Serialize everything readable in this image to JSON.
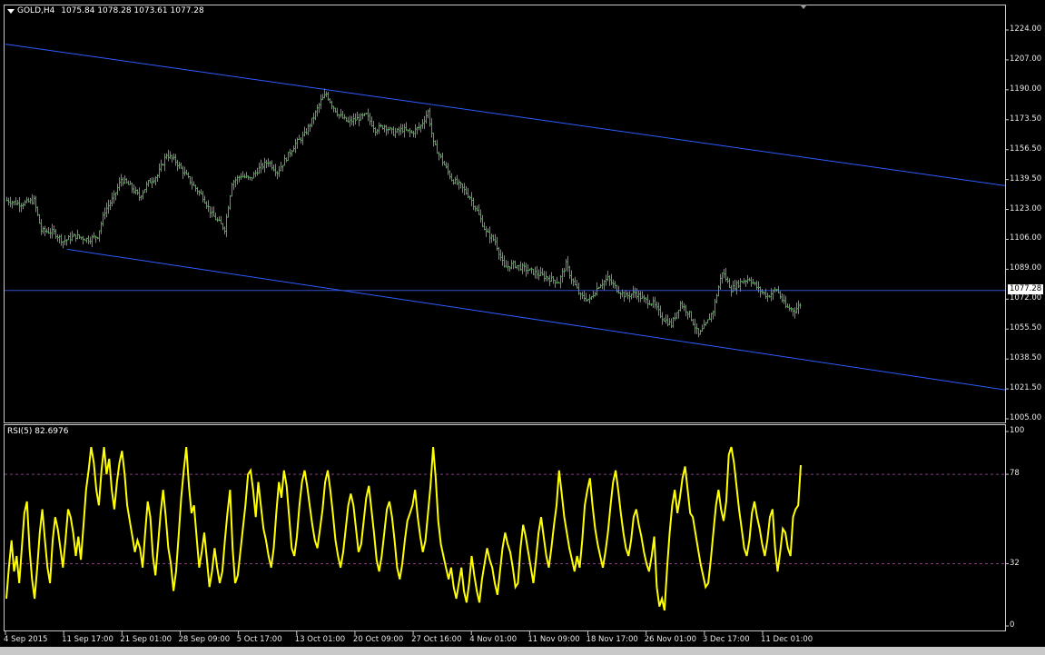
{
  "header": {
    "symbol": "GOLD,H4",
    "open": "1075.84",
    "high": "1078.28",
    "low": "1073.61",
    "close": "1077.28"
  },
  "indicator": {
    "name": "RSI(5)",
    "value": "82.6976"
  },
  "current_price_label": "1077.28",
  "chart_data": [
    {
      "type": "ohlc",
      "symbol": "GOLD",
      "timeframe": "H4",
      "y_ticks": [
        "1224.00",
        "1207.00",
        "1190.00",
        "1173.50",
        "1156.50",
        "1139.50",
        "1123.00",
        "1106.00",
        "1089.00",
        "1072.00",
        "1055.50",
        "1038.50",
        "1021.50",
        "1005.00"
      ],
      "ylim": [
        1005,
        1224
      ],
      "x_ticks": [
        "4 Sep 2015",
        "11 Sep 17:00",
        "21 Sep 01:00",
        "28 Sep 09:00",
        "5 Oct 17:00",
        "13 Oct 01:00",
        "20 Oct 09:00",
        "27 Oct 16:00",
        "4 Nov 01:00",
        "11 Nov 09:00",
        "18 Nov 17:00",
        "26 Nov 01:00",
        "3 Dec 17:00",
        "11 Dec 01:00"
      ],
      "close_path": [
        [
          0,
          1128
        ],
        [
          15,
          1126
        ],
        [
          30,
          1128
        ],
        [
          38,
          1111
        ],
        [
          52,
          1110
        ],
        [
          62,
          1105
        ],
        [
          75,
          1108
        ],
        [
          90,
          1106
        ],
        [
          100,
          1108
        ],
        [
          108,
          1122
        ],
        [
          118,
          1130
        ],
        [
          126,
          1140
        ],
        [
          136,
          1136
        ],
        [
          146,
          1130
        ],
        [
          156,
          1138
        ],
        [
          166,
          1142
        ],
        [
          176,
          1154
        ],
        [
          186,
          1150
        ],
        [
          196,
          1143
        ],
        [
          206,
          1136
        ],
        [
          216,
          1130
        ],
        [
          226,
          1120
        ],
        [
          240,
          1112
        ],
        [
          248,
          1138
        ],
        [
          258,
          1142
        ],
        [
          268,
          1140
        ],
        [
          278,
          1146
        ],
        [
          288,
          1150
        ],
        [
          298,
          1144
        ],
        [
          308,
          1152
        ],
        [
          318,
          1160
        ],
        [
          328,
          1165
        ],
        [
          338,
          1175
        ],
        [
          346,
          1184
        ],
        [
          352,
          1188
        ],
        [
          358,
          1182
        ],
        [
          366,
          1176
        ],
        [
          376,
          1172
        ],
        [
          386,
          1174
        ],
        [
          396,
          1176
        ],
        [
          406,
          1168
        ],
        [
          416,
          1170
        ],
        [
          426,
          1166
        ],
        [
          436,
          1168
        ],
        [
          446,
          1166
        ],
        [
          456,
          1170
        ],
        [
          464,
          1178
        ],
        [
          470,
          1160
        ],
        [
          480,
          1150
        ],
        [
          490,
          1140
        ],
        [
          500,
          1136
        ],
        [
          510,
          1130
        ],
        [
          518,
          1122
        ],
        [
          528,
          1110
        ],
        [
          538,
          1105
        ],
        [
          548,
          1090
        ],
        [
          558,
          1092
        ],
        [
          568,
          1090
        ],
        [
          578,
          1088
        ],
        [
          588,
          1086
        ],
        [
          598,
          1084
        ],
        [
          608,
          1082
        ],
        [
          616,
          1092
        ],
        [
          622,
          1084
        ],
        [
          632,
          1074
        ],
        [
          642,
          1072
        ],
        [
          652,
          1080
        ],
        [
          662,
          1084
        ],
        [
          672,
          1078
        ],
        [
          682,
          1074
        ],
        [
          692,
          1076
        ],
        [
          702,
          1072
        ],
        [
          712,
          1070
        ],
        [
          722,
          1062
        ],
        [
          732,
          1058
        ],
        [
          742,
          1070
        ],
        [
          752,
          1064
        ],
        [
          762,
          1052
        ],
        [
          770,
          1058
        ],
        [
          778,
          1066
        ],
        [
          788,
          1088
        ],
        [
          798,
          1078
        ],
        [
          808,
          1082
        ],
        [
          818,
          1084
        ],
        [
          828,
          1078
        ],
        [
          838,
          1074
        ],
        [
          848,
          1078
        ],
        [
          858,
          1068
        ],
        [
          868,
          1066
        ],
        [
          878,
          1072
        ],
        [
          882,
          1077.28
        ]
      ],
      "channel_upper": {
        "x": [
          0,
          1105
        ],
        "y": [
          1216.0,
          1136.0
        ]
      },
      "channel_lower": {
        "x": [
          68,
          1105
        ],
        "y": [
          1100.5,
          1021.0
        ]
      },
      "horizontal_line": 1077.28,
      "line_colors": {
        "bars": "#3cb43c",
        "channel": "#2d5bff",
        "hline": "#3050c8"
      }
    },
    {
      "type": "line",
      "name": "RSI(5)",
      "y_ticks": [
        "100",
        "78",
        "32",
        "0"
      ],
      "ylim": [
        0,
        100
      ],
      "levels": [
        78,
        32
      ],
      "color": "#ffff00",
      "level_color": "#9c2e9c",
      "values": [
        14,
        30,
        44,
        28,
        36,
        22,
        40,
        58,
        64,
        40,
        24,
        14,
        30,
        48,
        60,
        44,
        30,
        22,
        44,
        56,
        50,
        40,
        30,
        44,
        60,
        56,
        48,
        36,
        46,
        34,
        52,
        70,
        80,
        92,
        84,
        70,
        62,
        80,
        92,
        78,
        86,
        70,
        60,
        74,
        84,
        90,
        78,
        62,
        54,
        46,
        38,
        44,
        40,
        30,
        48,
        64,
        56,
        36,
        26,
        42,
        58,
        70,
        56,
        40,
        32,
        18,
        28,
        46,
        66,
        80,
        92,
        72,
        58,
        62,
        46,
        30,
        38,
        48,
        34,
        20,
        28,
        40,
        30,
        22,
        28,
        44,
        58,
        70,
        40,
        22,
        26,
        38,
        50,
        62,
        78,
        80,
        70,
        56,
        74,
        62,
        50,
        44,
        36,
        30,
        40,
        58,
        74,
        66,
        80,
        72,
        56,
        40,
        36,
        46,
        62,
        74,
        80,
        72,
        62,
        52,
        44,
        40,
        50,
        60,
        74,
        80,
        70,
        58,
        44,
        36,
        30,
        38,
        50,
        62,
        68,
        62,
        50,
        38,
        42,
        54,
        66,
        72,
        60,
        48,
        34,
        28,
        36,
        48,
        60,
        64,
        56,
        44,
        30,
        24,
        32,
        44,
        54,
        58,
        62,
        70,
        56,
        46,
        38,
        44,
        58,
        72,
        92,
        76,
        54,
        42,
        36,
        30,
        24,
        30,
        20,
        14,
        22,
        30,
        18,
        12,
        22,
        36,
        26,
        18,
        12,
        24,
        32,
        40,
        34,
        30,
        22,
        16,
        28,
        40,
        48,
        42,
        38,
        30,
        20,
        22,
        40,
        52,
        46,
        38,
        30,
        22,
        34,
        48,
        56,
        46,
        36,
        30,
        40,
        52,
        62,
        80,
        68,
        56,
        48,
        40,
        34,
        28,
        36,
        30,
        44,
        62,
        70,
        76,
        62,
        50,
        42,
        36,
        30,
        38,
        48,
        62,
        74,
        80,
        70,
        58,
        48,
        40,
        36,
        44,
        56,
        60,
        52,
        46,
        38,
        32,
        28,
        36,
        46,
        20,
        10,
        14,
        8,
        30,
        48,
        62,
        70,
        58,
        66,
        76,
        82,
        70,
        58,
        56,
        48,
        40,
        32,
        26,
        20,
        22,
        34,
        48,
        62,
        70,
        60,
        54,
        64,
        88,
        92,
        84,
        72,
        60,
        50,
        40,
        36,
        44,
        58,
        64,
        56,
        50,
        42,
        36,
        44,
        56,
        60,
        40,
        28,
        38,
        50,
        48,
        40,
        36,
        56,
        60,
        62,
        82.6976
      ]
    }
  ]
}
